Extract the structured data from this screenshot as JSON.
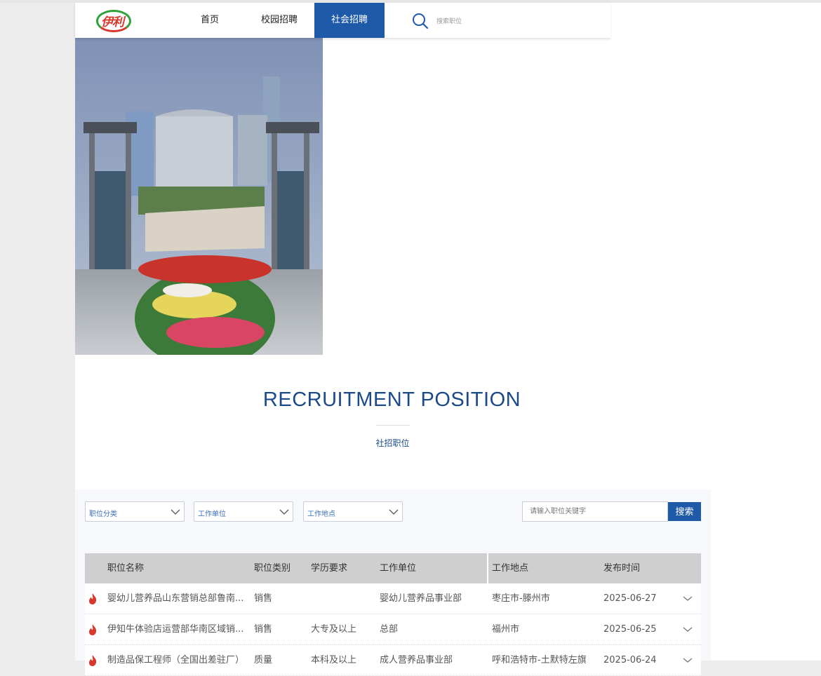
{
  "brand": {
    "logo_text": "伊利"
  },
  "nav": {
    "items": [
      {
        "label": "首页"
      },
      {
        "label": "校园招聘"
      },
      {
        "label": "社会招聘"
      }
    ],
    "active_index": 2,
    "search_placeholder": "搜索职位"
  },
  "section": {
    "title": "RECRUITMENT POSITION",
    "subtitle": "社招职位"
  },
  "filters": {
    "category": "职位分类",
    "unit": "工作单位",
    "location": "工作地点",
    "keyword_placeholder": "请输入职位关键字",
    "search_button": "搜索"
  },
  "table": {
    "headers": [
      "职位名称",
      "职位类别",
      "学历要求",
      "工作单位",
      "工作地点",
      "发布时间"
    ],
    "rows": [
      {
        "name": "婴幼儿营养品山东营销总部鲁南...",
        "category": "销售",
        "education": "",
        "unit": "婴幼儿营养品事业部",
        "location": "枣庄市-滕州市",
        "date": "2025-06-27"
      },
      {
        "name": "伊知牛体验店运营部华南区域销...",
        "category": "销售",
        "education": "大专及以上",
        "unit": "总部",
        "location": "福州市",
        "date": "2025-06-25"
      },
      {
        "name": "制造品保工程师（全国出差驻厂）",
        "category": "质量",
        "education": "本科及以上",
        "unit": "成人营养品事业部",
        "location": "呼和浩特市-土默特左旗",
        "date": "2025-06-24"
      }
    ]
  },
  "colors": {
    "primary": "#1f5aa9",
    "title": "#1b4a8a",
    "hot": "#d8392e"
  }
}
